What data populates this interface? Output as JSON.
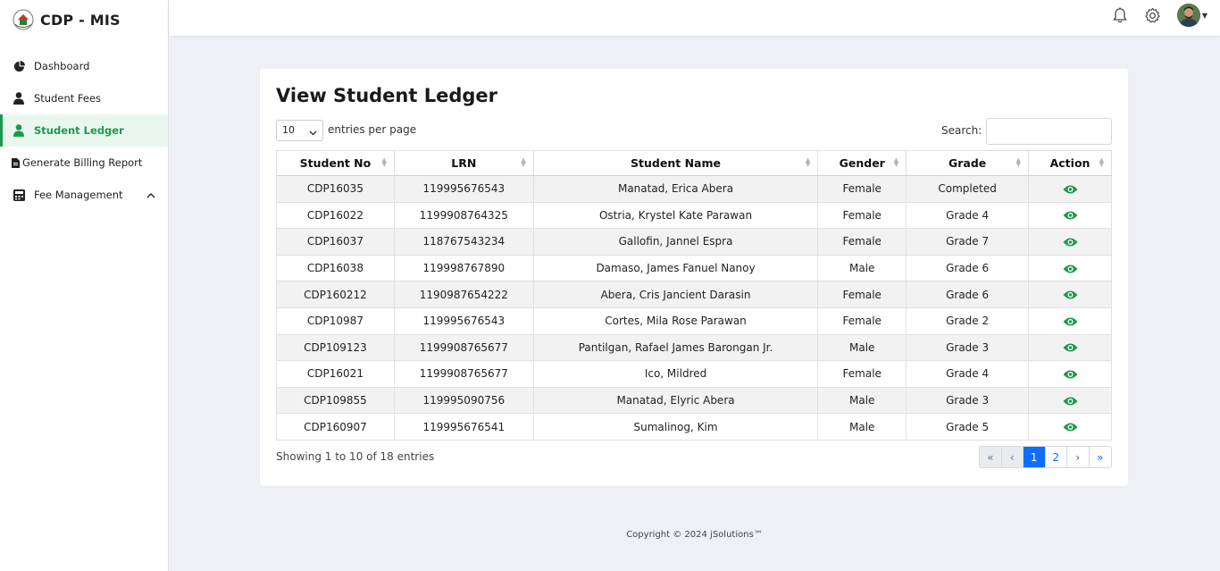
{
  "brand": {
    "name": "CDP - MIS"
  },
  "sidebar": {
    "items": [
      {
        "label": "Dashboard",
        "icon": "pie-chart-icon",
        "active": false
      },
      {
        "label": "Student Fees",
        "icon": "user-icon",
        "active": false
      },
      {
        "label": "Student Ledger",
        "icon": "user-icon",
        "active": true
      },
      {
        "label": "Generate Billing Report",
        "icon": "document-icon",
        "active": false
      },
      {
        "label": "Fee Management",
        "icon": "calculator-icon",
        "active": false,
        "expanded": true
      }
    ]
  },
  "topbar": {
    "icons": [
      "bell-icon",
      "gear-icon",
      "user-avatar"
    ]
  },
  "page": {
    "title": "View Student Ledger",
    "entries_value": "10",
    "entries_label": "entries per page",
    "search_label": "Search:",
    "search_value": ""
  },
  "table": {
    "columns": [
      "Student No",
      "LRN",
      "Student Name",
      "Gender",
      "Grade",
      "Action"
    ],
    "rows": [
      [
        "CDP16035",
        "119995676543",
        "Manatad, Erica Abera",
        "Female",
        "Completed"
      ],
      [
        "CDP16022",
        "1199908764325",
        "Ostria, Krystel Kate Parawan",
        "Female",
        "Grade 4"
      ],
      [
        "CDP16037",
        "118767543234",
        "Gallofin, Jannel Espra",
        "Female",
        "Grade 7"
      ],
      [
        "CDP16038",
        "119998767890",
        "Damaso, James Fanuel Nanoy",
        "Male",
        "Grade 6"
      ],
      [
        "CDP160212",
        "1190987654222",
        "Abera, Cris Jancient Darasin",
        "Female",
        "Grade 6"
      ],
      [
        "CDP10987",
        "119995676543",
        "Cortes, Mila Rose Parawan",
        "Female",
        "Grade 2"
      ],
      [
        "CDP109123",
        "1199908765677",
        "Pantilgan, Rafael James Barongan Jr.",
        "Male",
        "Grade 3"
      ],
      [
        "CDP16021",
        "1199908765677",
        "Ico, Mildred",
        "Female",
        "Grade 4"
      ],
      [
        "CDP109855",
        "119995090756",
        "Manatad, Elyric Abera",
        "Male",
        "Grade 3"
      ],
      [
        "CDP160907",
        "119995676541",
        "Sumalinog, Kim",
        "Male",
        "Grade 5"
      ]
    ]
  },
  "info": "Showing 1 to 10 of 18 entries",
  "pagination": [
    "«",
    "‹",
    "1",
    "2",
    "›",
    "»"
  ],
  "footer": "Copyright © 2024 jSolutions™",
  "colors": {
    "accent": "#1c9a4b",
    "primary": "#0d6efd"
  }
}
